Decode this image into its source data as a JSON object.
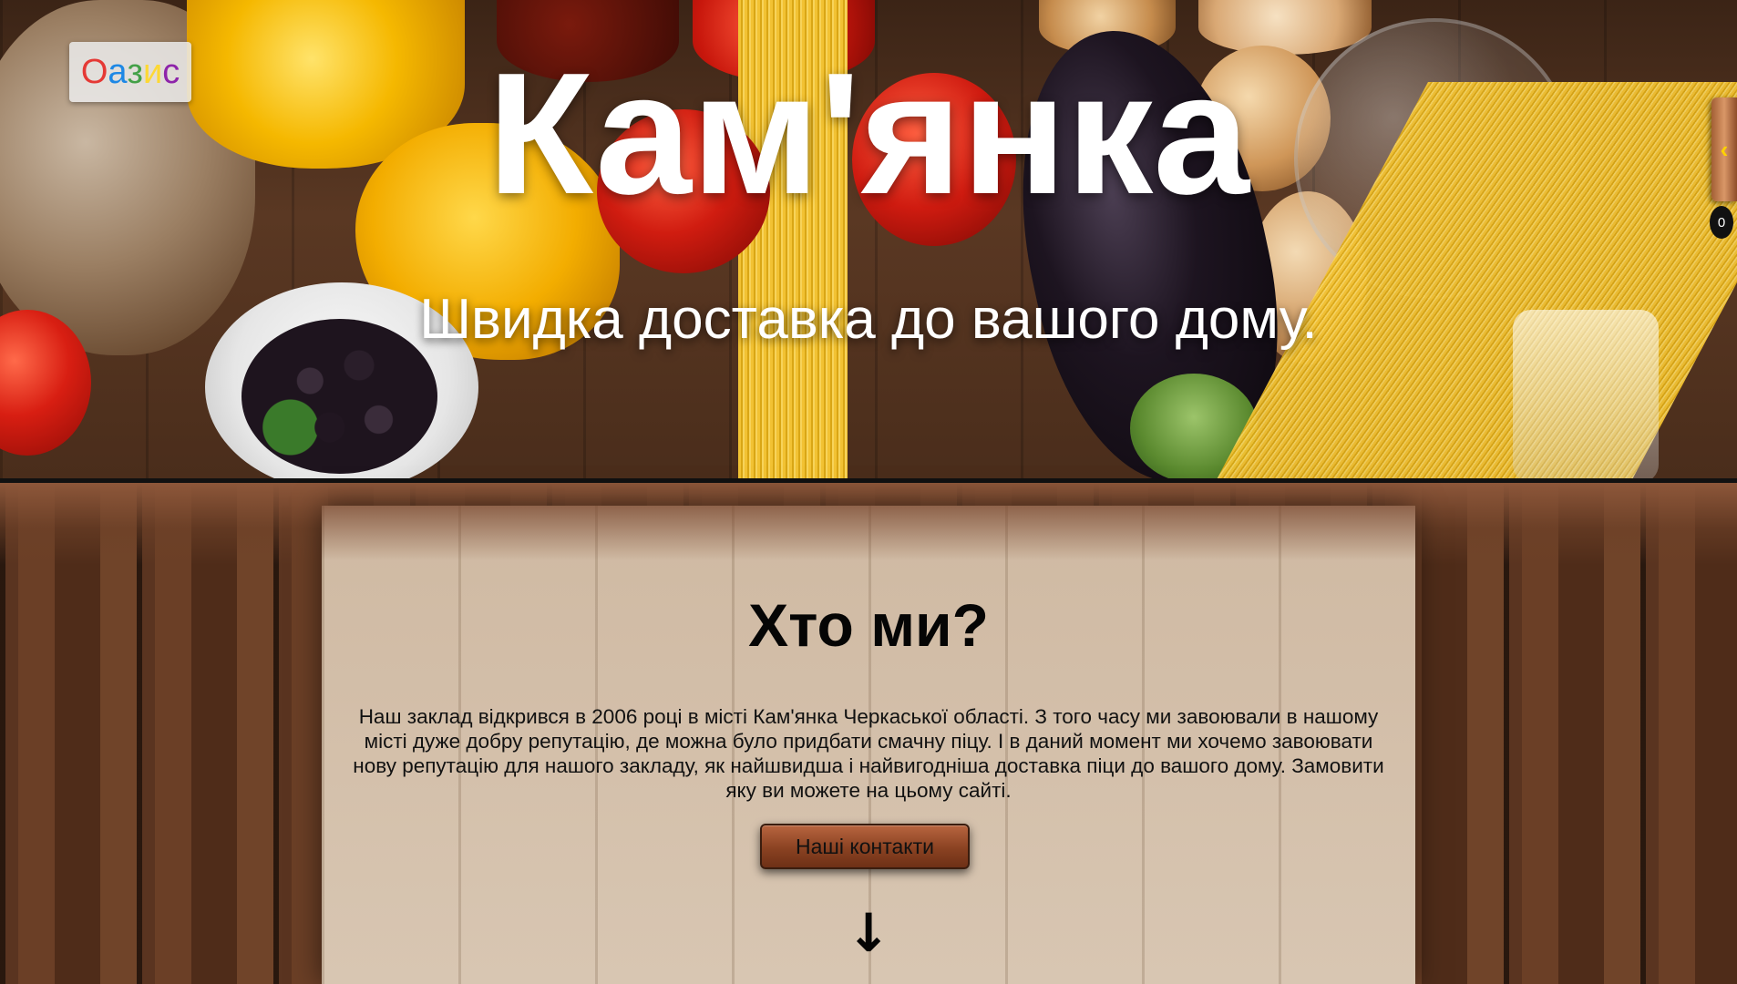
{
  "brand": {
    "letters": [
      {
        "char": "О",
        "color": "#e53935"
      },
      {
        "char": "а",
        "color": "#1e88e5"
      },
      {
        "char": "з",
        "color": "#43a047"
      },
      {
        "char": "и",
        "color": "#fdd835"
      },
      {
        "char": "с",
        "color": "#8e24aa"
      }
    ]
  },
  "hero": {
    "title": "Кам'янка",
    "subtitle": "Швидка доставка до вашого дому."
  },
  "side_panel": {
    "toggle_icon": "chevron-left-icon",
    "toggle_glyph": "‹",
    "cart_count": "0"
  },
  "about": {
    "title": "Хто ми?",
    "text": "Наш заклад відкрився в 2006 році в місті Кам'янка Черкаської області. З того часу ми завоювали в нашому місті дуже добру репутацію, де можна було придбати смачну піцу. І в даний момент ми хочемо завоювати нову репутацію для нашого закладу, як найшвидша і найвигодніша доставка піци до вашого дому. Замовити яку ви можете на цьому сайті.",
    "contact_button": "Наші контакти",
    "scroll_icon": "arrow-down-icon",
    "scroll_glyph": "↓"
  },
  "colors": {
    "button_brown": "#8a4222",
    "accent_yellow": "#ffd200",
    "panel_wood": "#d8c6b2"
  }
}
